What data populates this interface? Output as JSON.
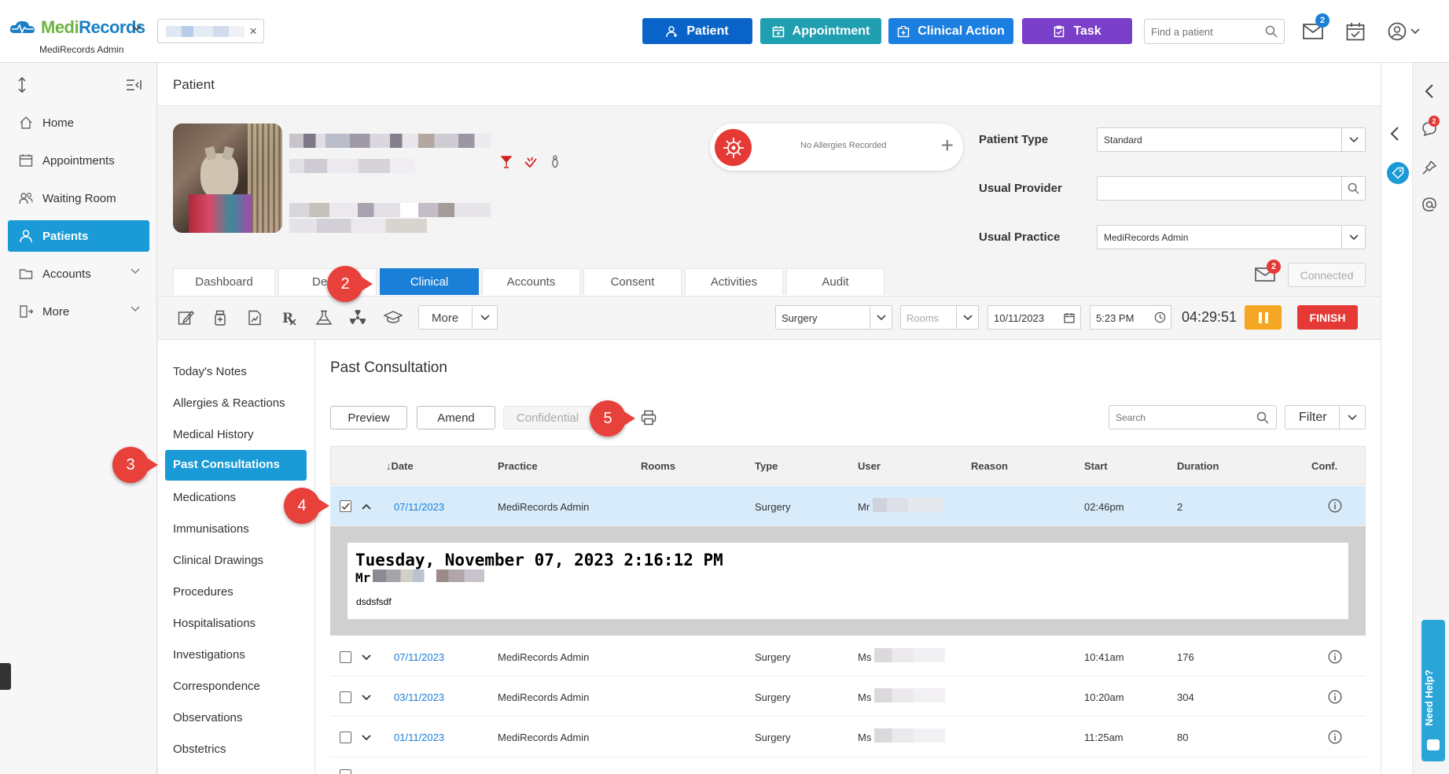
{
  "app": {
    "logo_medi": "Medi",
    "logo_records": "Records",
    "subtitle": "MediRecords Admin"
  },
  "header": {
    "buttons": [
      {
        "label": "Patient",
        "color": "#0a63c9"
      },
      {
        "label": "Appointment",
        "color": "#1f9fb0"
      },
      {
        "label": "Clinical Action",
        "color": "#1a7fe0"
      },
      {
        "label": "Task",
        "color": "#7a3fc8"
      }
    ],
    "find_placeholder": "Find a patient",
    "mail_badge": "2"
  },
  "nav": {
    "items": [
      {
        "label": "Home",
        "icon": "home-icon"
      },
      {
        "label": "Appointments",
        "icon": "calendar-icon"
      },
      {
        "label": "Waiting Room",
        "icon": "people-icon"
      },
      {
        "label": "Patients",
        "icon": "person-icon",
        "active": true
      },
      {
        "label": "Accounts",
        "icon": "folder-icon"
      },
      {
        "label": "More",
        "icon": "more-icon"
      }
    ]
  },
  "page": {
    "title": "Patient"
  },
  "patient": {
    "allergy_text": "No Allergies Recorded",
    "patient_type_label": "Patient Type",
    "patient_type_value": "Standard",
    "usual_provider_label": "Usual Provider",
    "usual_provider_value": "",
    "usual_practice_label": "Usual Practice",
    "usual_practice_value": "MediRecords Admin",
    "tabs": [
      "Dashboard",
      "De",
      "Clinical",
      "Accounts",
      "Consent",
      "Activities",
      "Audit"
    ],
    "active_tab": "Clinical",
    "connected_label": "Connected",
    "message_badge": "2"
  },
  "toolbar": {
    "more_label": "More",
    "location": "Surgery",
    "rooms_placeholder": "Rooms",
    "date": "10/11/2023",
    "time": "5:23 PM",
    "timer": "04:29:51",
    "finish_label": "FINISH"
  },
  "subnav": {
    "items": [
      "Today's Notes",
      "Allergies & Reactions",
      "Medical History",
      "Past Consultations",
      "Medications",
      "Immunisations",
      "Clinical Drawings",
      "Procedures",
      "Hospitalisations",
      "Investigations",
      "Correspondence",
      "Observations",
      "Obstetrics"
    ],
    "active": "Past Consultations"
  },
  "consult": {
    "title": "Past Consultation",
    "preview_label": "Preview",
    "amend_label": "Amend",
    "confidential_label": "Confidential",
    "search_placeholder": "Search",
    "filter_label": "Filter",
    "columns": [
      "↓Date",
      "Practice",
      "Rooms",
      "Type",
      "User",
      "Reason",
      "Start",
      "Duration",
      "Conf."
    ],
    "rows": [
      {
        "date": "07/11/2023",
        "practice": "MediRecords Admin",
        "rooms": "",
        "type": "Surgery",
        "user": "Mr",
        "reason": "",
        "start": "02:46pm",
        "duration": "2",
        "checked": true,
        "expanded": true
      },
      {
        "date": "07/11/2023",
        "practice": "MediRecords Admin",
        "rooms": "",
        "type": "Surgery",
        "user": "Ms",
        "reason": "",
        "start": "10:41am",
        "duration": "176"
      },
      {
        "date": "03/11/2023",
        "practice": "MediRecords Admin",
        "rooms": "",
        "type": "Surgery",
        "user": "Ms",
        "reason": "",
        "start": "10:20am",
        "duration": "304"
      },
      {
        "date": "01/11/2023",
        "practice": "MediRecords Admin",
        "rooms": "",
        "type": "Surgery",
        "user": "Ms",
        "reason": "",
        "start": "11:25am",
        "duration": "80"
      }
    ],
    "detail": {
      "heading": "Tuesday, November 07, 2023 2:16:12 PM",
      "name_prefix": "Mr",
      "note": "dsdsfsdf"
    }
  },
  "callouts": [
    "2",
    "3",
    "4",
    "5"
  ],
  "help_label": "Need Help?",
  "right_badge": "2"
}
